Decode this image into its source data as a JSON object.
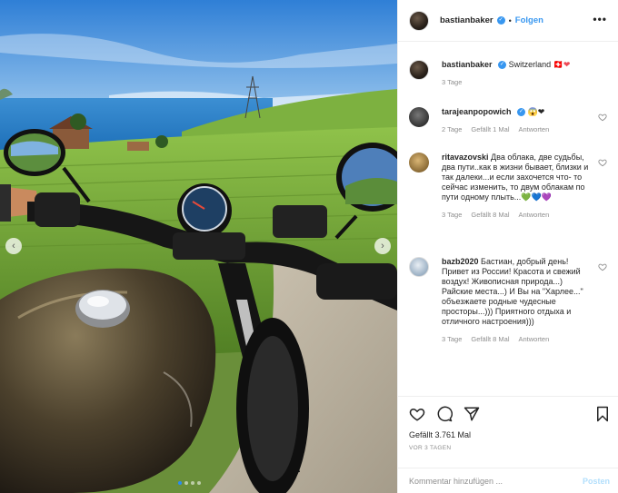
{
  "post": {
    "username": "bastianbaker",
    "verified": true,
    "follow_label": "Folgen",
    "header_separator": "•",
    "more_label": "•••"
  },
  "caption": {
    "username": "bastianbaker",
    "text": "Switzerland",
    "emoji": "🇨🇭❤",
    "time": "3 Tage"
  },
  "comments": [
    {
      "username": "tarajeanpopowich",
      "verified": true,
      "text": "😱❤",
      "time": "2 Tage",
      "likes": "Gefällt 1 Mal",
      "reply": "Antworten"
    },
    {
      "username": "ritavazovski",
      "verified": false,
      "text": "Два облака, две судьбы, два пути..как в жизни бывает, близки и так далеки...и если захочется что- то сейчас изменить, то двум облакам по пути одному плыть...💚💙💜",
      "time": "3 Tage",
      "likes": "Gefällt 8 Mal",
      "reply": "Antworten"
    },
    {
      "username": "bazb2020",
      "verified": false,
      "text": "Бастиан, добрый день! Привет из России! Красота и свежий воздух! Живописная природа...) Райские места...) И Вы на \"Харлее...\" объезжаете родные чудесные просторы...))) Приятного отдыха и отличного настроения)))",
      "time": "3 Tage",
      "likes": "Gefällt 8 Mal",
      "reply": "Antworten"
    }
  ],
  "footer": {
    "likes": "Gefällt 3.761 Mal",
    "ago": "VOR 3 TAGEN",
    "comment_placeholder": "Kommentar hinzufügen ...",
    "post_label": "Posten"
  },
  "carousel": {
    "prev": "‹",
    "next": "›",
    "slide_count": 4,
    "active_slide": 1
  },
  "icons": {
    "like": "heart-outline-icon",
    "comment": "comment-bubble-icon",
    "share": "paper-plane-icon",
    "save": "bookmark-icon"
  },
  "colors": {
    "link_blue": "#3897f0",
    "muted": "#8e8e8e",
    "post_disabled": "#b2dffc"
  }
}
